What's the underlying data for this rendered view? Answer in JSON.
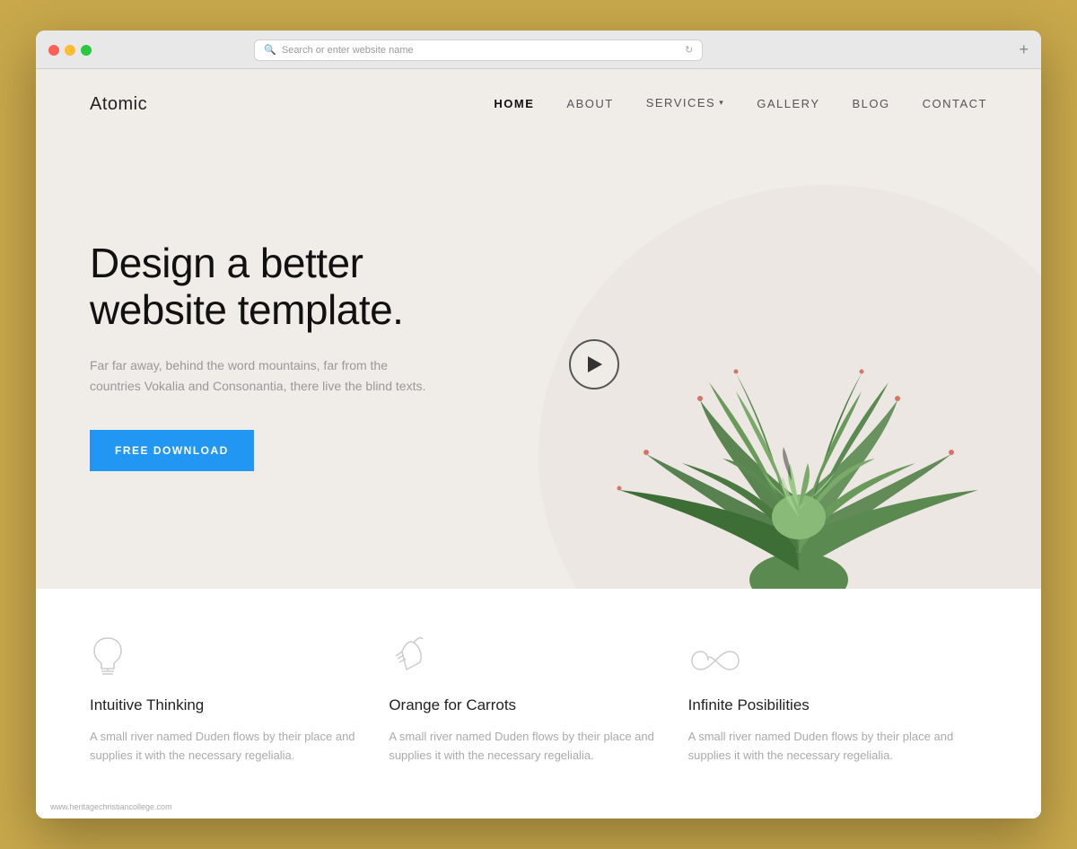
{
  "browser": {
    "address_placeholder": "Search or enter website name",
    "new_tab_icon": "+"
  },
  "nav": {
    "logo": "Atomic",
    "links": [
      {
        "label": "HOME",
        "active": true
      },
      {
        "label": "ABOUT",
        "active": false
      },
      {
        "label": "SERVICES",
        "active": false,
        "has_dropdown": true
      },
      {
        "label": "GALLERY",
        "active": false
      },
      {
        "label": "BLOG",
        "active": false
      },
      {
        "label": "CONTACT",
        "active": false
      }
    ]
  },
  "hero": {
    "heading": "Design a better\nwebsite template.",
    "heading_line1": "Design a better",
    "heading_line2": "website template.",
    "subtext": "Far far away, behind the word mountains, far from the countries Vokalia and Consonantia, there live the blind texts.",
    "cta_label": "FREE DOWNLOAD",
    "play_button_label": "Play video"
  },
  "features": [
    {
      "icon": "lightbulb",
      "title": "Intuitive Thinking",
      "description": "A small river named Duden flows by their place and supplies it with the necessary regelialia."
    },
    {
      "icon": "carrot",
      "title": "Orange for Carrots",
      "description": "A small river named Duden flows by their place and supplies it with the necessary regelialia."
    },
    {
      "icon": "infinity",
      "title": "Infinite Posibilities",
      "description": "A small river named Duden flows by their place and supplies it with the necessary regelialia."
    }
  ],
  "watermark": "www.heritagechristiancollege.com",
  "colors": {
    "cta_bg": "#2196F3",
    "nav_active": "#111111",
    "heading_color": "#111111",
    "body_bg": "#f0ece8",
    "features_bg": "#ffffff"
  }
}
